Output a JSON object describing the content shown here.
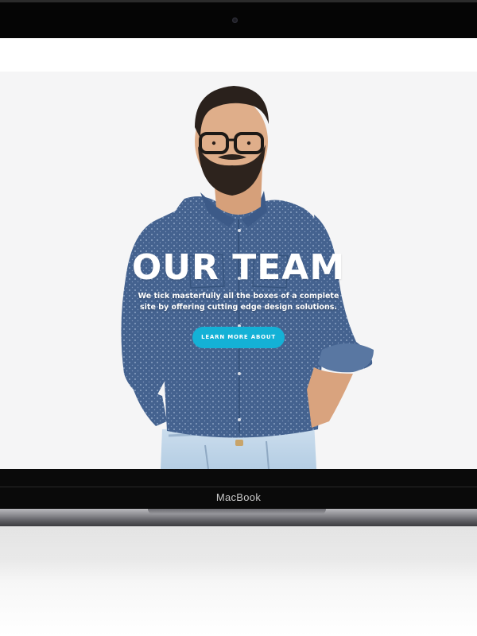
{
  "hero": {
    "title": "OUR TEAM",
    "subtitle": "We tick masterfully all the boxes of a complete site by offering cutting edge design solutions.",
    "button_label": "LEARN MORE ABOUT"
  },
  "device": {
    "label": "MacBook"
  },
  "colors": {
    "accent": "#14b1d6",
    "hero_background": "#f5f5f6",
    "bezel": "#050505"
  }
}
